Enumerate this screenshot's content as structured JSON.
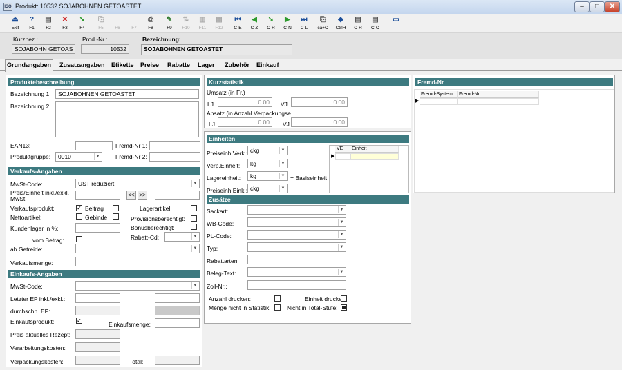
{
  "window": {
    "title": "Produkt: 10532 SOJABOHNEN GETOASTET",
    "app_icon": "app-icon",
    "controls": {
      "min": "–",
      "max": "□",
      "close": "✕"
    }
  },
  "toolbar": [
    {
      "label": "Exit",
      "glyph": "⏏",
      "color": "#1d4f9a",
      "enabled": true
    },
    {
      "label": "F1",
      "glyph": "?",
      "color": "#1d4f9a",
      "enabled": true
    },
    {
      "label": "F2",
      "glyph": "▤",
      "color": "#555555",
      "enabled": true
    },
    {
      "label": "F3",
      "glyph": "✕",
      "color": "#cc2222",
      "enabled": true
    },
    {
      "label": "F4",
      "glyph": "➘",
      "color": "#2e9a2e",
      "enabled": true
    },
    {
      "label": "F5",
      "glyph": "⎘",
      "color": "#999999",
      "enabled": false
    },
    {
      "label": "F6",
      "glyph": "",
      "color": "#999999",
      "enabled": false
    },
    {
      "label": "F7",
      "glyph": "",
      "color": "#999999",
      "enabled": false
    },
    {
      "label": "F8",
      "glyph": "⎙",
      "color": "#555555",
      "enabled": true
    },
    {
      "label": "F9",
      "glyph": "✎",
      "color": "#2e7a2e",
      "enabled": true
    },
    {
      "label": "F10",
      "glyph": "⇅",
      "color": "#999999",
      "enabled": false
    },
    {
      "label": "F11",
      "glyph": "▥",
      "color": "#999999",
      "enabled": false
    },
    {
      "label": "F12",
      "glyph": "▦",
      "color": "#999999",
      "enabled": false
    },
    {
      "label": "C-E",
      "glyph": "⏮",
      "color": "#1d4f9a",
      "enabled": true
    },
    {
      "label": "C-Z",
      "glyph": "◀",
      "color": "#2e9a2e",
      "enabled": true
    },
    {
      "label": "C-R",
      "glyph": "➘",
      "color": "#2e9a2e",
      "enabled": true
    },
    {
      "label": "C-N",
      "glyph": "▶",
      "color": "#2e9a2e",
      "enabled": true
    },
    {
      "label": "C-L",
      "glyph": "⏭",
      "color": "#1d4f9a",
      "enabled": true
    },
    {
      "label": "ca+C",
      "glyph": "⎘",
      "color": "#555555",
      "enabled": true
    },
    {
      "label": "CtrlH",
      "glyph": "◆",
      "color": "#1d4f9a",
      "enabled": true
    },
    {
      "label": "C-R",
      "glyph": "▤",
      "color": "#555555",
      "enabled": true
    },
    {
      "label": "C-O",
      "glyph": "▤",
      "color": "#555555",
      "enabled": true
    },
    {
      "label": "",
      "glyph": "▭",
      "color": "#1d4f9a",
      "enabled": true
    }
  ],
  "header": {
    "kurzbez_label": "Kurzbez.:",
    "kurzbez": "SOJABOHN GETOAS",
    "prodnr_label": "Prod.-Nr.:",
    "prodnr": "10532",
    "bez_label": "Bezeichnung:",
    "bez": "SOJABOHNEN GETOASTET"
  },
  "tabs": [
    "Grundangaben",
    "Zusatzangaben",
    "Etikette",
    "Preise",
    "Rabatte",
    "Lager",
    "Zubehör",
    "Einkauf"
  ],
  "produkt": {
    "section": "Produktebeschreibung",
    "bez1_label": "Bezeichnung 1:",
    "bez1": "SOJABOHNEN GETOASTET",
    "bez2_label": "Bezeichnung 2:",
    "bez2": "",
    "ean_label": "EAN13:",
    "ean": "",
    "fremd1_label": "Fremd-Nr 1:",
    "fremd1": "",
    "pgruppe_label": "Produktgruppe:",
    "pgruppe": "0010",
    "fremd2_label": "Fremd-Nr 2:",
    "fremd2": ""
  },
  "verkauf": {
    "section": "Verkaufs-Angaben",
    "mwst_label": "MwSt-Code:",
    "mwst": "UST reduziert",
    "preis_label": "Preis/Einheit inkl./exkl. MwSt",
    "nav_prev": "<<",
    "nav_next": ">>",
    "vprod_label": "Verkaufsprodukt:",
    "beitrag_label": "Beitrag",
    "lager_label": "Lagerartikel:",
    "netto_label": "Nettoartikel:",
    "gebinde_label": "Gebinde",
    "prov_label": "Provisionsberechtigt:",
    "kunden_label": "Kundenlager in %:",
    "bonus_label": "Bonusberechtigt:",
    "vombetrag_label": "vom Betrag:",
    "rabatt_label": "Rabatt-Cd:",
    "getreide_label": "ab Getreide:",
    "vmenge_label": "Verkaufsmenge:"
  },
  "einkauf": {
    "section": "Einkaufs-Angaben",
    "mwst_label": "MwSt-Code:",
    "ep_label": "Letzter EP inkl./exkl.:",
    "dep_label": "durchschn. EP:",
    "eprod_label": "Einkaufsprodukt:",
    "emenge_label": "Einkaufsmenge:",
    "rezept_label": "Preis aktuelles Rezept:",
    "verarb_label": "Verarbeitungskosten:",
    "verpack_label": "Verpackungskosten:",
    "total_label": "Total:"
  },
  "kurzstatistik": {
    "section": "Kurzstatistik",
    "umsatz_label": "Umsatz (in Fr.)",
    "lj": "LJ",
    "vj": "VJ",
    "u_lj": "0.00",
    "u_vj": "0.00",
    "absatz_label": "Absatz (in Anzahl Verpackungse",
    "a_lj": "0.00",
    "a_vj": "0.00"
  },
  "einheiten": {
    "section": "Einheiten",
    "pe_label": "Preiseinh.Verk.:",
    "pe": "ckg",
    "ve_label": "Verp.Einheit:",
    "ve": "kg",
    "le_label": "Lagereinheit:",
    "le": "kg",
    "basis_label": "= Basiseinheit",
    "pee_label": "Preiseinh.Eink.:",
    "pee": "ckg",
    "grid_cols": [
      "VE",
      "Einheit"
    ]
  },
  "zusaetze": {
    "section": "Zusätze",
    "sackart_label": "Sackart:",
    "wb_label": "WB-Code:",
    "pl_label": "PL-Code:",
    "typ_label": "Typ:",
    "rabattarten_label": "Rabattarten:",
    "beleg_label": "Beleg-Text:",
    "zoll_label": "Zoll-Nr.:",
    "anzahl_label": "Anzahl drucken:",
    "einheit_label": "Einheit drucken:",
    "menge_label": "Menge nicht in Statistik:",
    "total_label": "Nicht in Total-Stufe:"
  },
  "fremdnr": {
    "section": "Fremd-Nr",
    "cols": [
      "Fremd-System",
      "Fremd-Nr"
    ]
  },
  "colors": {
    "section": "#3d7a80",
    "titlebar": "#c4d6ee"
  }
}
